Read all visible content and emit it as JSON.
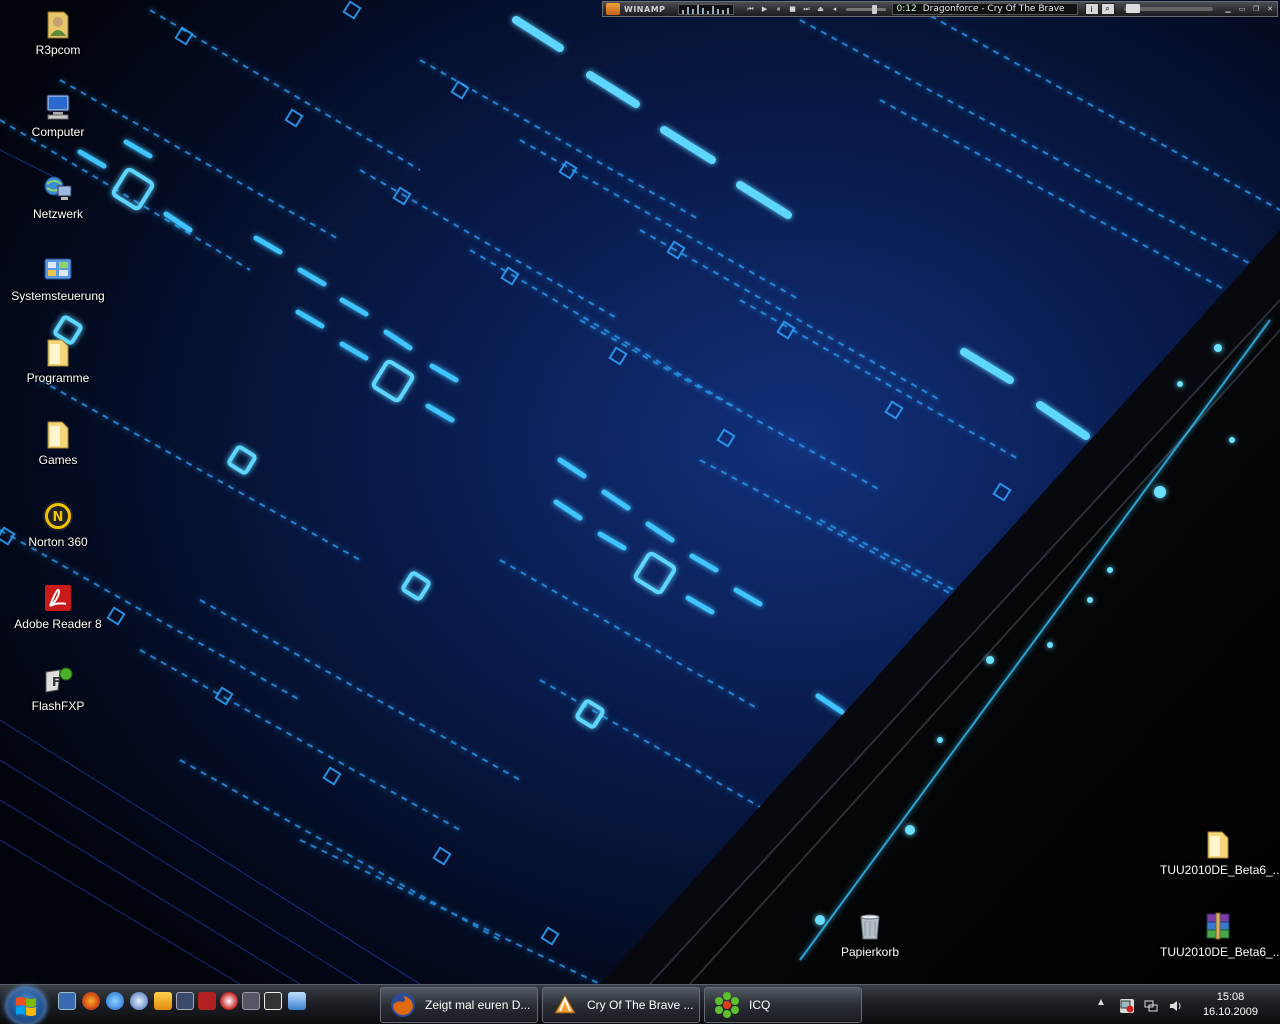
{
  "desktop": {
    "icons_left": [
      {
        "label": "R3pcom",
        "icon": "user-folder-icon"
      },
      {
        "label": "Computer",
        "icon": "computer-icon"
      },
      {
        "label": "Netzwerk",
        "icon": "network-icon"
      },
      {
        "label": "Systemsteuerung",
        "icon": "control-panel-icon"
      },
      {
        "label": "Programme",
        "icon": "folder-icon"
      },
      {
        "label": "Games",
        "icon": "folder-icon"
      },
      {
        "label": "Norton 360",
        "icon": "norton-icon"
      },
      {
        "label": "Adobe Reader 8",
        "icon": "adobe-reader-icon"
      },
      {
        "label": "FlashFXP",
        "icon": "flashfxp-icon"
      }
    ],
    "recycle_bin": {
      "label": "Papierkorb",
      "icon": "recycle-bin-icon"
    },
    "icons_right": [
      {
        "label": "TUU2010DE_Beta6_...",
        "icon": "folder-icon"
      },
      {
        "label": "TUU2010DE_Beta6_...",
        "icon": "winrar-archive-icon"
      }
    ]
  },
  "winamp": {
    "title": "WINAMP",
    "time": "0:12",
    "track": "Dragonforce - Cry Of The Brave",
    "btn_info": "i",
    "btn_search": "⌕"
  },
  "taskbar": {
    "tasks": [
      {
        "label": "Zeigt mal euren D...",
        "icon": "firefox-icon"
      },
      {
        "label": "Cry Of The Brave ...",
        "icon": "winamp-icon"
      },
      {
        "label": "ICQ",
        "icon": "icq-icon"
      }
    ],
    "clock": {
      "time": "15:08",
      "date": "16.10.2009"
    }
  },
  "colors": {
    "glow": "#38c8ff",
    "wallpaper_deep": "#0a1a4a",
    "taskbar": "#1d2025"
  }
}
